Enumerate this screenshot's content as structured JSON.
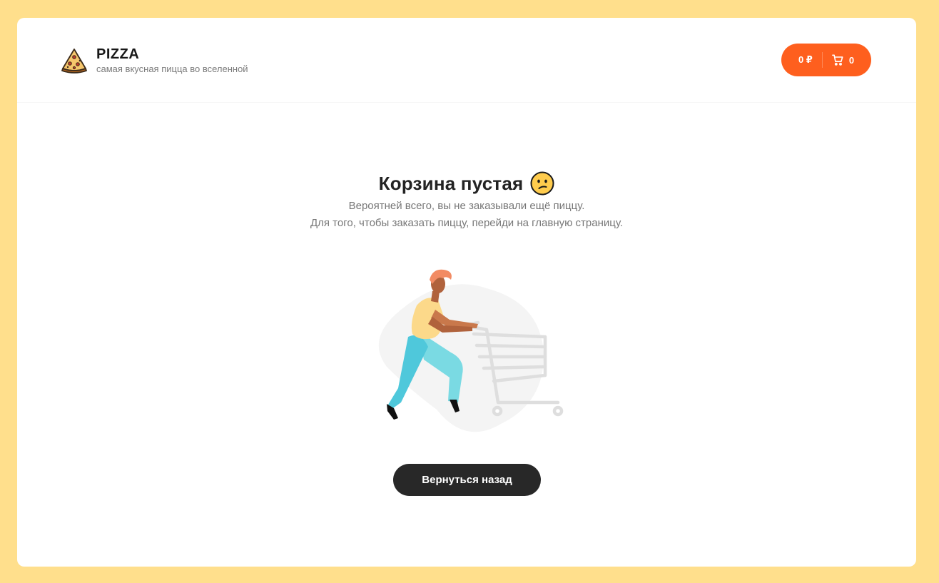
{
  "header": {
    "logo_title": "PIZZA",
    "logo_subtitle": "самая вкусная пицца во вселенной",
    "logo_icon": "pizza-slice-icon"
  },
  "cart_button": {
    "price": "0 ₽",
    "count": "0",
    "icon": "cart-icon"
  },
  "empty_cart": {
    "title": "Корзина пустая",
    "emoji_icon": "confused-face-icon",
    "description_line1": "Вероятней всего, вы не заказывали ещё пиццу.",
    "description_line2": "Для того, чтобы заказать пиццу, перейди на главную страницу.",
    "illustration": "person-pushing-shopping-cart",
    "back_button_label": "Вернуться назад"
  },
  "colors": {
    "page_background": "#FFDF8C",
    "accent": "#FE5F1E",
    "dark_button": "#282828"
  }
}
